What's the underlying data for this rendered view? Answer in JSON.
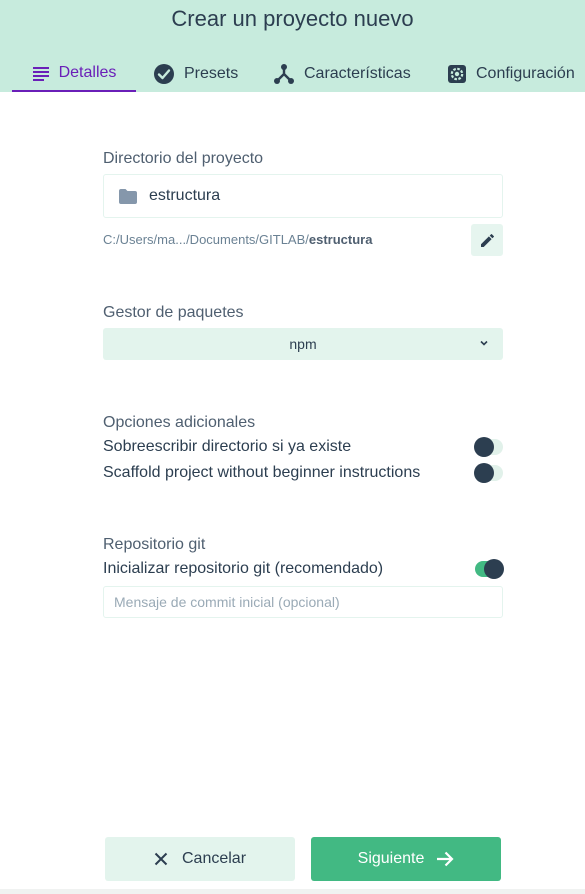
{
  "header": {
    "title": "Crear un proyecto nuevo",
    "tabs": [
      {
        "label": "Detalles",
        "icon": "list-icon",
        "active": true
      },
      {
        "label": "Presets",
        "icon": "check-circle-icon",
        "active": false
      },
      {
        "label": "Características",
        "icon": "merge-icon",
        "active": false
      },
      {
        "label": "Configuración",
        "icon": "settings-icon",
        "active": false
      }
    ]
  },
  "directory": {
    "label": "Directorio del proyecto",
    "value": "estructura",
    "path_prefix": "C:/Users/ma.../Documents/GITLAB/",
    "path_folder": "estructura"
  },
  "package_manager": {
    "label": "Gestor de paquetes",
    "selected": "npm"
  },
  "options": {
    "label": "Opciones adicionales",
    "items": [
      {
        "label": "Sobreescribir directorio si ya existe",
        "enabled": false
      },
      {
        "label": "Scaffold project without beginner instructions",
        "enabled": false
      }
    ]
  },
  "git": {
    "label": "Repositorio git",
    "init_label": "Inicializar repositorio git (recomendado)",
    "init_enabled": true,
    "commit_placeholder": "Mensaje de commit inicial (opcional)"
  },
  "footer": {
    "cancel_label": "Cancelar",
    "next_label": "Siguiente"
  },
  "colors": {
    "header_bg": "#c7ebdd",
    "accent_active_tab": "#6a1fb8",
    "primary_green": "#42b983",
    "text_dark": "#2c3e50"
  }
}
